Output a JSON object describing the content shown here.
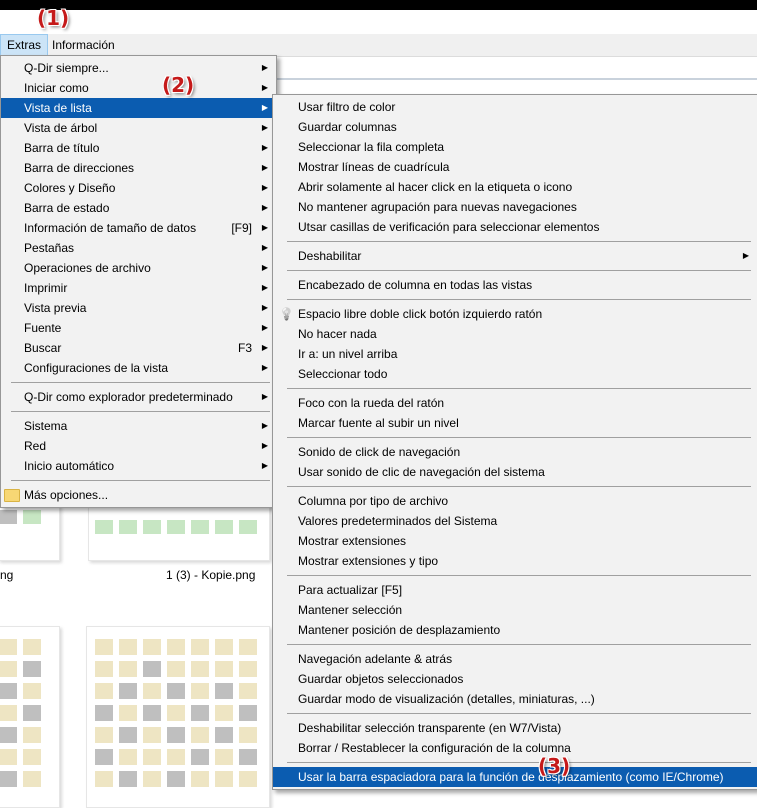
{
  "callouts": {
    "c1": "(1)",
    "c2": "(2)",
    "c3": "(3)"
  },
  "menubar": {
    "extras": "Extras",
    "info": "Información"
  },
  "files": {
    "left_partial": "ng",
    "right": "1 (3) - Kopie.png"
  },
  "extras_menu": [
    {
      "label": "Q-Dir siempre...",
      "arrow": true
    },
    {
      "label": "Iniciar como",
      "arrow": true
    },
    {
      "label": "Vista de lista",
      "arrow": true,
      "highlighted": true
    },
    {
      "label": "Vista de árbol",
      "arrow": true
    },
    {
      "label": "Barra de título",
      "arrow": true
    },
    {
      "label": "Barra de direcciones",
      "arrow": true
    },
    {
      "label": "Colores y Diseño",
      "arrow": true
    },
    {
      "label": "Barra de estado",
      "arrow": true
    },
    {
      "label": "Información de tamaño de datos",
      "shortcut": "[F9]",
      "arrow": true
    },
    {
      "label": "Pestañas",
      "arrow": true
    },
    {
      "label": "Operaciones de archivo",
      "arrow": true
    },
    {
      "label": "Imprimir",
      "arrow": true
    },
    {
      "label": "Vista previa",
      "arrow": true
    },
    {
      "label": "Fuente",
      "arrow": true
    },
    {
      "label": "Buscar",
      "shortcut": "F3",
      "arrow": true
    },
    {
      "label": "Configuraciones de la vista",
      "arrow": true
    },
    {
      "sep": true
    },
    {
      "label": "Q-Dir como explorador predeterminado",
      "arrow": true
    },
    {
      "sep": true
    },
    {
      "label": "Sistema",
      "arrow": true
    },
    {
      "label": "Red",
      "arrow": true
    },
    {
      "label": "Inicio automático",
      "arrow": true
    },
    {
      "sep": true
    },
    {
      "label": "Más opciones...",
      "icon": "folder-icon"
    }
  ],
  "listview_menu": [
    {
      "label": "Usar filtro de color"
    },
    {
      "label": "Guardar columnas"
    },
    {
      "label": "Seleccionar la fila completa"
    },
    {
      "label": "Mostrar líneas de cuadrícula"
    },
    {
      "label": "Abrir solamente al hacer click en la etiqueta o icono"
    },
    {
      "label": "No mantener agrupación para nuevas navegaciones"
    },
    {
      "label": "Utsar casillas de verificación para seleccionar elementos"
    },
    {
      "sep": true
    },
    {
      "label": "Deshabilitar",
      "arrow": true
    },
    {
      "sep": true
    },
    {
      "label": "Encabezado de columna en todas las vistas"
    },
    {
      "sep": true
    },
    {
      "label": "Espacio libre doble click botón izquierdo ratón",
      "icon": "lightbulb-icon"
    },
    {
      "label": "No hacer nada"
    },
    {
      "label": "Ir a: un nivel arriba"
    },
    {
      "label": "Seleccionar todo"
    },
    {
      "sep": true
    },
    {
      "label": "Foco con la rueda del ratón"
    },
    {
      "label": "Marcar fuente al subir un nivel"
    },
    {
      "sep": true
    },
    {
      "label": "Sonido de click de navegación"
    },
    {
      "label": "Usar sonido de clic de navegación del sistema"
    },
    {
      "sep": true
    },
    {
      "label": "Columna por tipo de archivo"
    },
    {
      "label": "Valores predeterminados del Sistema"
    },
    {
      "label": "Mostrar extensiones"
    },
    {
      "label": "Mostrar extensiones y tipo"
    },
    {
      "sep": true
    },
    {
      "label": "Para actualizar [F5]"
    },
    {
      "label": "Mantener selección"
    },
    {
      "label": "Mantener posición de desplazamiento"
    },
    {
      "sep": true
    },
    {
      "label": "Navegación adelante & atrás"
    },
    {
      "label": "Guardar objetos seleccionados"
    },
    {
      "label": "Guardar modo de visualización (detalles, miniaturas, ...)"
    },
    {
      "sep": true
    },
    {
      "label": "Deshabilitar selección transparente (en W7/Vista)"
    },
    {
      "label": "Borrar / Restablecer la configuración de la columna"
    },
    {
      "sep": true
    },
    {
      "label": "Usar la barra espaciadora para la función de desplazamiento (como IE/Chrome)",
      "highlighted": true
    }
  ]
}
